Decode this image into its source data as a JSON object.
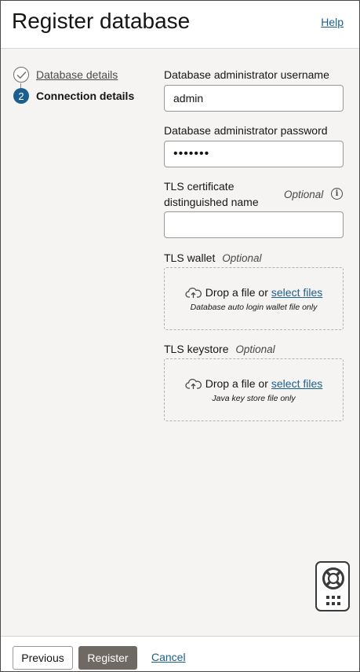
{
  "header": {
    "title": "Register database",
    "help_label": "Help"
  },
  "steps": [
    {
      "label": "Database details",
      "state": "completed",
      "icon": "check-icon"
    },
    {
      "number": "2",
      "label": "Connection details",
      "state": "current"
    }
  ],
  "form": {
    "username": {
      "label": "Database administrator username",
      "value": "admin"
    },
    "password": {
      "label": "Database administrator password",
      "masked_value": "•••••••"
    },
    "tls_dn": {
      "label_line1": "TLS certificate",
      "label_line2": "distinguished name",
      "optional": "Optional",
      "value": "",
      "info_icon": "i"
    },
    "tls_wallet": {
      "label": "TLS wallet",
      "optional": "Optional",
      "drop_text": "Drop a file or",
      "select_link": "select files",
      "hint": "Database auto login wallet file only"
    },
    "tls_keystore": {
      "label": "TLS keystore",
      "optional": "Optional",
      "drop_text": "Drop a file or",
      "select_link": "select files",
      "hint": "Java key store file only"
    }
  },
  "footer": {
    "previous_label": "Previous",
    "register_label": "Register",
    "cancel_label": "Cancel"
  },
  "colors": {
    "accent": "#1b5f8c",
    "primary_button": "#6f6964",
    "panel_bg": "#f5f4f2"
  },
  "icons": {
    "upload": "cloud-upload-icon",
    "support": "lifebuoy-icon",
    "apps": "grid-dots-icon"
  }
}
